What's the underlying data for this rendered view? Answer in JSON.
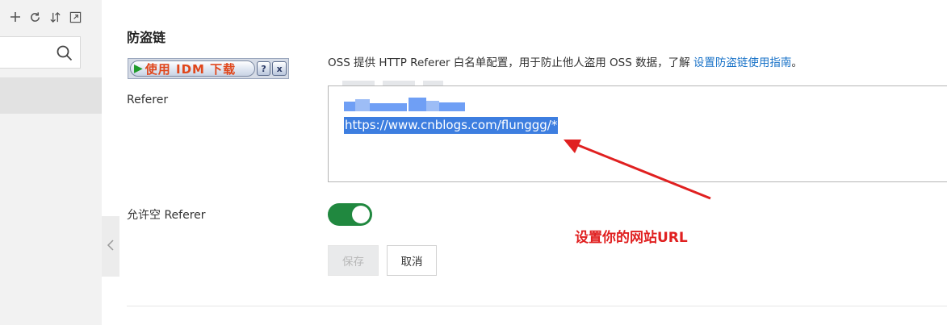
{
  "sidebar": {
    "toolbar_icons": [
      "plus-icon",
      "refresh-icon",
      "sort-icon",
      "expand-icon"
    ],
    "search": {
      "value": "",
      "placeholder": "",
      "icon": "search-icon"
    },
    "collapse_icon": "chevron-left-icon"
  },
  "main": {
    "section_title": "防盗链",
    "idm": {
      "label": "使用 IDM 下载",
      "help": "?",
      "close": "x"
    },
    "description": "OSS 提供 HTTP Referer 白名单配置，用于防止他人盗用 OSS 数据，了解",
    "description_link": "设置防盗链使用指南",
    "description_end": "。",
    "referer_label": "Referer",
    "referer_value_visible": "https://www.cnblogs.com/flunggg/*",
    "allow_empty_label": "允许空 Referer",
    "allow_empty_enabled": true,
    "annotation": "设置你的网站URL",
    "save_label": "保存",
    "cancel_label": "取消"
  },
  "colors": {
    "toggle_on": "#20883f",
    "link": "#1a73c8",
    "annotation": "#e02020",
    "selection": "#3d7ee0"
  }
}
